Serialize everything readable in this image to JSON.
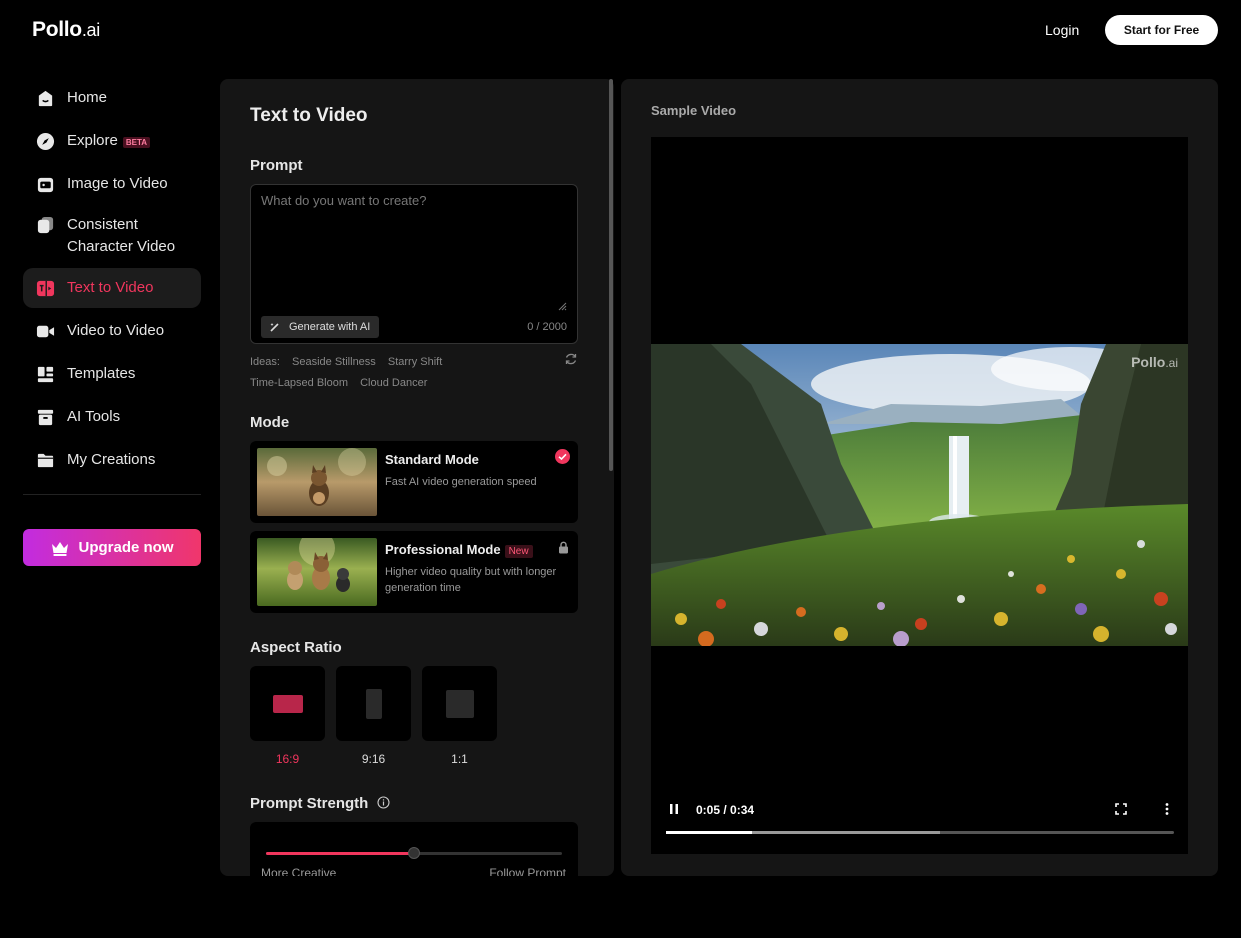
{
  "header": {
    "logo_main": "Pollo",
    "logo_suffix": ".ai",
    "login": "Login",
    "start_free": "Start for Free"
  },
  "sidebar": {
    "items": [
      {
        "label": "Home",
        "icon": "home-icon"
      },
      {
        "label": "Explore",
        "icon": "compass-icon",
        "badge": "BETA"
      },
      {
        "label": "Image to Video",
        "icon": "image-video-icon"
      },
      {
        "label": "Consistent Character Video",
        "line1": "Consistent",
        "line2": "Character Video",
        "icon": "character-icon"
      },
      {
        "label": "Text to Video",
        "icon": "text-video-icon",
        "active": true
      },
      {
        "label": "Video to Video",
        "icon": "video-camera-icon"
      },
      {
        "label": "Templates",
        "icon": "templates-icon"
      },
      {
        "label": "AI Tools",
        "icon": "toolbox-icon"
      },
      {
        "label": "My Creations",
        "icon": "folder-icon"
      }
    ],
    "upgrade": "Upgrade now"
  },
  "form": {
    "title": "Text to Video",
    "prompt_label": "Prompt",
    "prompt_placeholder": "What do you want to create?",
    "prompt_value": "",
    "generate_ai": "Generate with AI",
    "char_count": "0 / 2000",
    "ideas_label": "Ideas:",
    "ideas": [
      "Seaside Stillness",
      "Starry Shift",
      "Time-Lapsed Bloom",
      "Cloud Dancer"
    ],
    "mode_label": "Mode",
    "modes": [
      {
        "name": "Standard Mode",
        "desc": "Fast AI video generation speed",
        "selected": true
      },
      {
        "name": "Professional Mode",
        "badge": "New",
        "desc": "Higher video quality but with longer generation time",
        "locked": true
      }
    ],
    "aspect_label": "Aspect Ratio",
    "aspect_ratios": [
      {
        "label": "16:9",
        "selected": true
      },
      {
        "label": "9:16",
        "selected": false
      },
      {
        "label": "1:1",
        "selected": false
      }
    ],
    "strength_label": "Prompt Strength",
    "strength_left": "More Creative",
    "strength_right": "Follow Prompt",
    "strength_value": 0.5
  },
  "preview": {
    "title": "Sample Video",
    "watermark_main": "Pollo",
    "watermark_suffix": ".ai",
    "time": "0:05 / 0:34",
    "progress_played": 0.17,
    "progress_buffered": 0.54
  },
  "colors": {
    "accent": "#f0365d",
    "background": "#000000",
    "panel": "#151515"
  }
}
